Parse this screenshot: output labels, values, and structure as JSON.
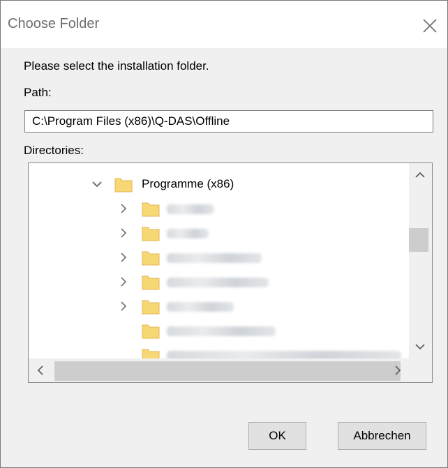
{
  "window": {
    "title": "Choose Folder"
  },
  "prompt": "Please select the installation folder.",
  "path": {
    "label": "Path:",
    "value": "C:\\Program Files (x86)\\Q-DAS\\Offline"
  },
  "directories": {
    "label": "Directories:",
    "expanded_folder": {
      "label": "Programme (x86)"
    }
  },
  "buttons": {
    "ok": "OK",
    "cancel": "Abbrechen"
  },
  "colors": {
    "folder": "#f8d775",
    "folder_dark": "#e8b84a",
    "chevron": "#707070"
  },
  "icons": [
    "close-icon",
    "chevron-down-icon",
    "chevron-right-icon",
    "folder-icon",
    "scroll-up-icon",
    "scroll-down-icon",
    "scroll-left-icon",
    "scroll-right-icon"
  ]
}
